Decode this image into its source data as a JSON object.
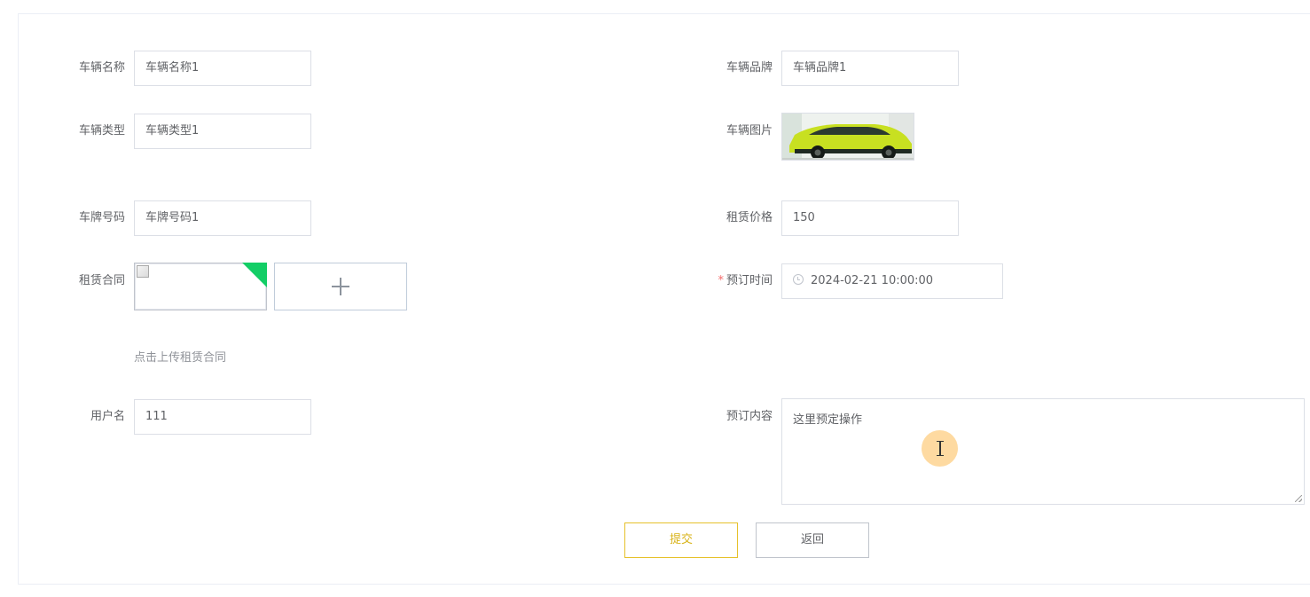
{
  "form": {
    "vehicle_name": {
      "label": "车辆名称",
      "value": "车辆名称1"
    },
    "vehicle_brand": {
      "label": "车辆品牌",
      "value": "车辆品牌1"
    },
    "vehicle_type": {
      "label": "车辆类型",
      "value": "车辆类型1"
    },
    "vehicle_image": {
      "label": "车辆图片"
    },
    "plate_number": {
      "label": "车牌号码",
      "value": "车牌号码1"
    },
    "rental_price": {
      "label": "租赁价格",
      "value": "150"
    },
    "rental_contract": {
      "label": "租赁合同",
      "tip": "点击上传租赁合同"
    },
    "booking_time": {
      "label": "预订时间",
      "required_mark": "*",
      "value": "2024-02-21 10:00:00"
    },
    "username": {
      "label": "用户名",
      "value": "111"
    },
    "booking_content": {
      "label": "预订内容",
      "value": "这里预定操作"
    }
  },
  "buttons": {
    "submit": "提交",
    "back": "返回"
  },
  "colors": {
    "required": "#f56c6c",
    "success_corner": "#13ce66",
    "submit_accent": "#e6c12b",
    "car_body": "#c8e021"
  },
  "icons": {
    "booking_time": "clock-icon",
    "upload": "plus-icon",
    "cursor": "ibeam-cursor-icon"
  }
}
